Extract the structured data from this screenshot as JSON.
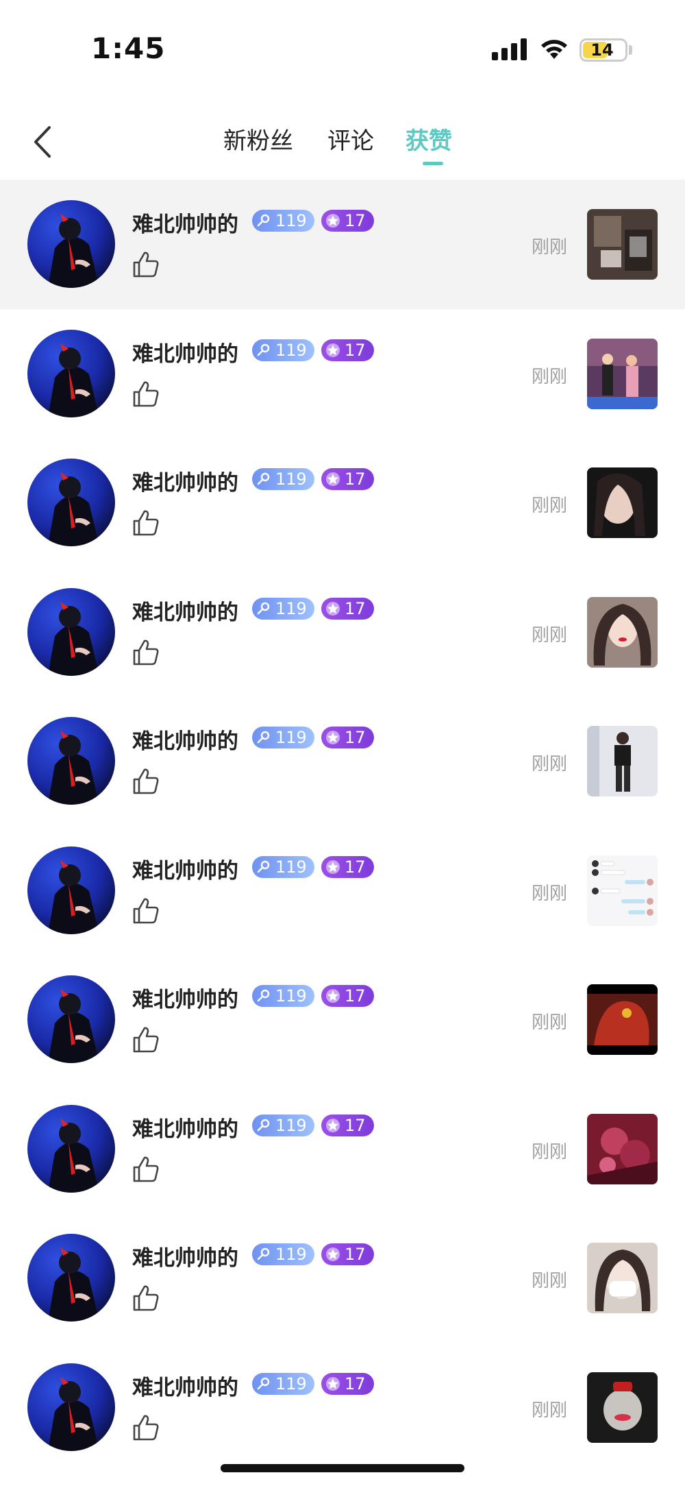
{
  "status_bar": {
    "time": "1:45",
    "battery": "14"
  },
  "nav": {
    "tabs": [
      {
        "label": "新粉丝"
      },
      {
        "label": "评论"
      },
      {
        "label": "获赞"
      }
    ],
    "active_tab": "获赞",
    "accent_color": "#5ec9c2"
  },
  "items": [
    {
      "name": "难北帅帅的",
      "fans_badge": "119",
      "level_badge": "17",
      "time": "刚刚",
      "thumb_icon": "photo-thumbnail"
    },
    {
      "name": "难北帅帅的",
      "fans_badge": "119",
      "level_badge": "17",
      "time": "刚刚",
      "thumb_icon": "photo-thumbnail"
    },
    {
      "name": "难北帅帅的",
      "fans_badge": "119",
      "level_badge": "17",
      "time": "刚刚",
      "thumb_icon": "photo-thumbnail"
    },
    {
      "name": "难北帅帅的",
      "fans_badge": "119",
      "level_badge": "17",
      "time": "刚刚",
      "thumb_icon": "photo-thumbnail"
    },
    {
      "name": "难北帅帅的",
      "fans_badge": "119",
      "level_badge": "17",
      "time": "刚刚",
      "thumb_icon": "photo-thumbnail"
    },
    {
      "name": "难北帅帅的",
      "fans_badge": "119",
      "level_badge": "17",
      "time": "刚刚",
      "thumb_icon": "chat-screenshot-thumbnail"
    },
    {
      "name": "难北帅帅的",
      "fans_badge": "119",
      "level_badge": "17",
      "time": "刚刚",
      "thumb_icon": "photo-thumbnail"
    },
    {
      "name": "难北帅帅的",
      "fans_badge": "119",
      "level_badge": "17",
      "time": "刚刚",
      "thumb_icon": "photo-thumbnail"
    },
    {
      "name": "难北帅帅的",
      "fans_badge": "119",
      "level_badge": "17",
      "time": "刚刚",
      "thumb_icon": "photo-thumbnail"
    },
    {
      "name": "难北帅帅的",
      "fans_badge": "119",
      "level_badge": "17",
      "time": "刚刚",
      "thumb_icon": "photo-thumbnail"
    }
  ]
}
